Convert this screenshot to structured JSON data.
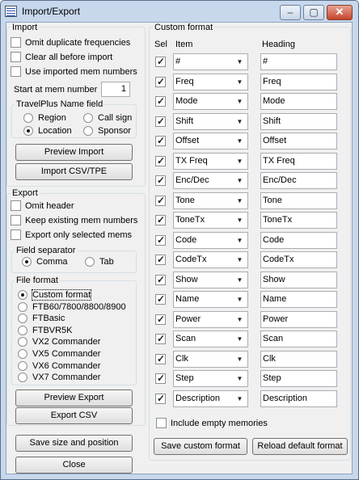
{
  "window": {
    "title": "Import/Export",
    "controls": {
      "minimize": "–",
      "maximize": "▢",
      "close": "✕"
    }
  },
  "import": {
    "title": "Import",
    "options": [
      {
        "label": "Omit duplicate frequencies",
        "checked": false
      },
      {
        "label": "Clear all before import",
        "checked": false
      },
      {
        "label": "Use imported mem numbers",
        "checked": false
      }
    ],
    "start_label": "Start at mem number",
    "start_value": "1",
    "name_field": {
      "title": "TravelPlus Name field",
      "options": [
        {
          "label": "Region",
          "selected": false
        },
        {
          "label": "Call sign",
          "selected": false
        },
        {
          "label": "Location",
          "selected": true
        },
        {
          "label": "Sponsor",
          "selected": false
        }
      ]
    },
    "preview_button": "Preview Import",
    "import_button": "Import CSV/TPE"
  },
  "export": {
    "title": "Export",
    "options": [
      {
        "label": "Omit header",
        "checked": false
      },
      {
        "label": "Keep existing mem numbers",
        "checked": false
      },
      {
        "label": "Export only selected mems",
        "checked": false
      }
    ],
    "separator": {
      "title": "Field separator",
      "options": [
        {
          "label": "Comma",
          "selected": true
        },
        {
          "label": "Tab",
          "selected": false
        }
      ]
    },
    "file_format": {
      "title": "File format",
      "options": [
        {
          "label": "Custom format",
          "selected": true
        },
        {
          "label": "FTB60/7800/8800/8900",
          "selected": false
        },
        {
          "label": "FTBasic",
          "selected": false
        },
        {
          "label": "FTBVR5K",
          "selected": false
        },
        {
          "label": "VX2 Commander",
          "selected": false
        },
        {
          "label": "VX5 Commander",
          "selected": false
        },
        {
          "label": "VX6 Commander",
          "selected": false
        },
        {
          "label": "VX7 Commander",
          "selected": false
        }
      ]
    },
    "preview_button": "Preview Export",
    "export_button": "Export CSV"
  },
  "bottom": {
    "save_button": "Save size and position",
    "close_button": "Close"
  },
  "custom": {
    "title": "Custom format",
    "col_sel": "Sel",
    "col_item": "Item",
    "col_heading": "Heading",
    "rows": [
      {
        "item": "#",
        "heading": "#",
        "sel": true
      },
      {
        "item": "Freq",
        "heading": "Freq",
        "sel": true
      },
      {
        "item": "Mode",
        "heading": "Mode",
        "sel": true
      },
      {
        "item": "Shift",
        "heading": "Shift",
        "sel": true
      },
      {
        "item": "Offset",
        "heading": "Offset",
        "sel": true
      },
      {
        "item": "TX Freq",
        "heading": "TX Freq",
        "sel": true
      },
      {
        "item": "Enc/Dec",
        "heading": "Enc/Dec",
        "sel": true
      },
      {
        "item": "Tone",
        "heading": "Tone",
        "sel": true
      },
      {
        "item": "ToneTx",
        "heading": "ToneTx",
        "sel": true
      },
      {
        "item": "Code",
        "heading": "Code",
        "sel": true
      },
      {
        "item": "CodeTx",
        "heading": "CodeTx",
        "sel": true
      },
      {
        "item": "Show",
        "heading": "Show",
        "sel": true
      },
      {
        "item": "Name",
        "heading": "Name",
        "sel": true
      },
      {
        "item": "Power",
        "heading": "Power",
        "sel": true
      },
      {
        "item": "Scan",
        "heading": "Scan",
        "sel": true
      },
      {
        "item": "Clk",
        "heading": "Clk",
        "sel": true
      },
      {
        "item": "Step",
        "heading": "Step",
        "sel": true
      },
      {
        "item": "Description",
        "heading": "Description",
        "sel": true
      }
    ],
    "include_empty": {
      "label": "Include empty memories",
      "checked": false
    },
    "save_button": "Save custom format",
    "reload_button": "Reload default format"
  }
}
